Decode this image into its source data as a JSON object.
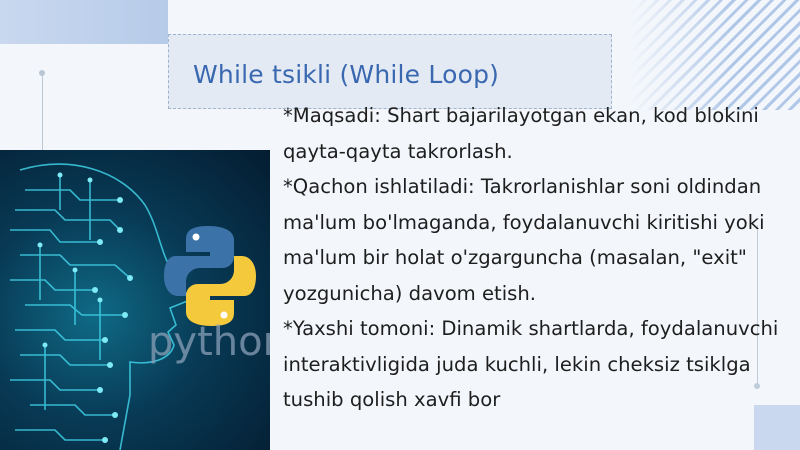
{
  "slide": {
    "title": "While tsikli (While Loop)",
    "paragraphs": [
      "*Maqsadi: Shart bajarilayotgan ekan, kod blokini qayta-qayta takrorlash.",
      "*Qachon ishlatiladi: Takrorlanishlar soni oldindan ma'lum bo'lmaganda, foydalanuvchi kiritishi yoki ma'lum bir holat o'zgarguncha (masalan, \"exit\" yozgunicha) davom etish.",
      "*Yaxshi tomoni: Dinamik shartlarda, foydalanuvchi interaktivligida juda kuchli, lekin cheksiz tsiklga tushib qolish xavfi bor"
    ],
    "image": {
      "logo_text": "python",
      "logo_colors": {
        "blue": "#3b73a8",
        "yellow": "#f4c93b"
      }
    }
  },
  "colors": {
    "title": "#3a68b0",
    "body_text": "#1e1e1e",
    "background": "#f3f6fb",
    "accent_panel": "#c9d8ef"
  }
}
